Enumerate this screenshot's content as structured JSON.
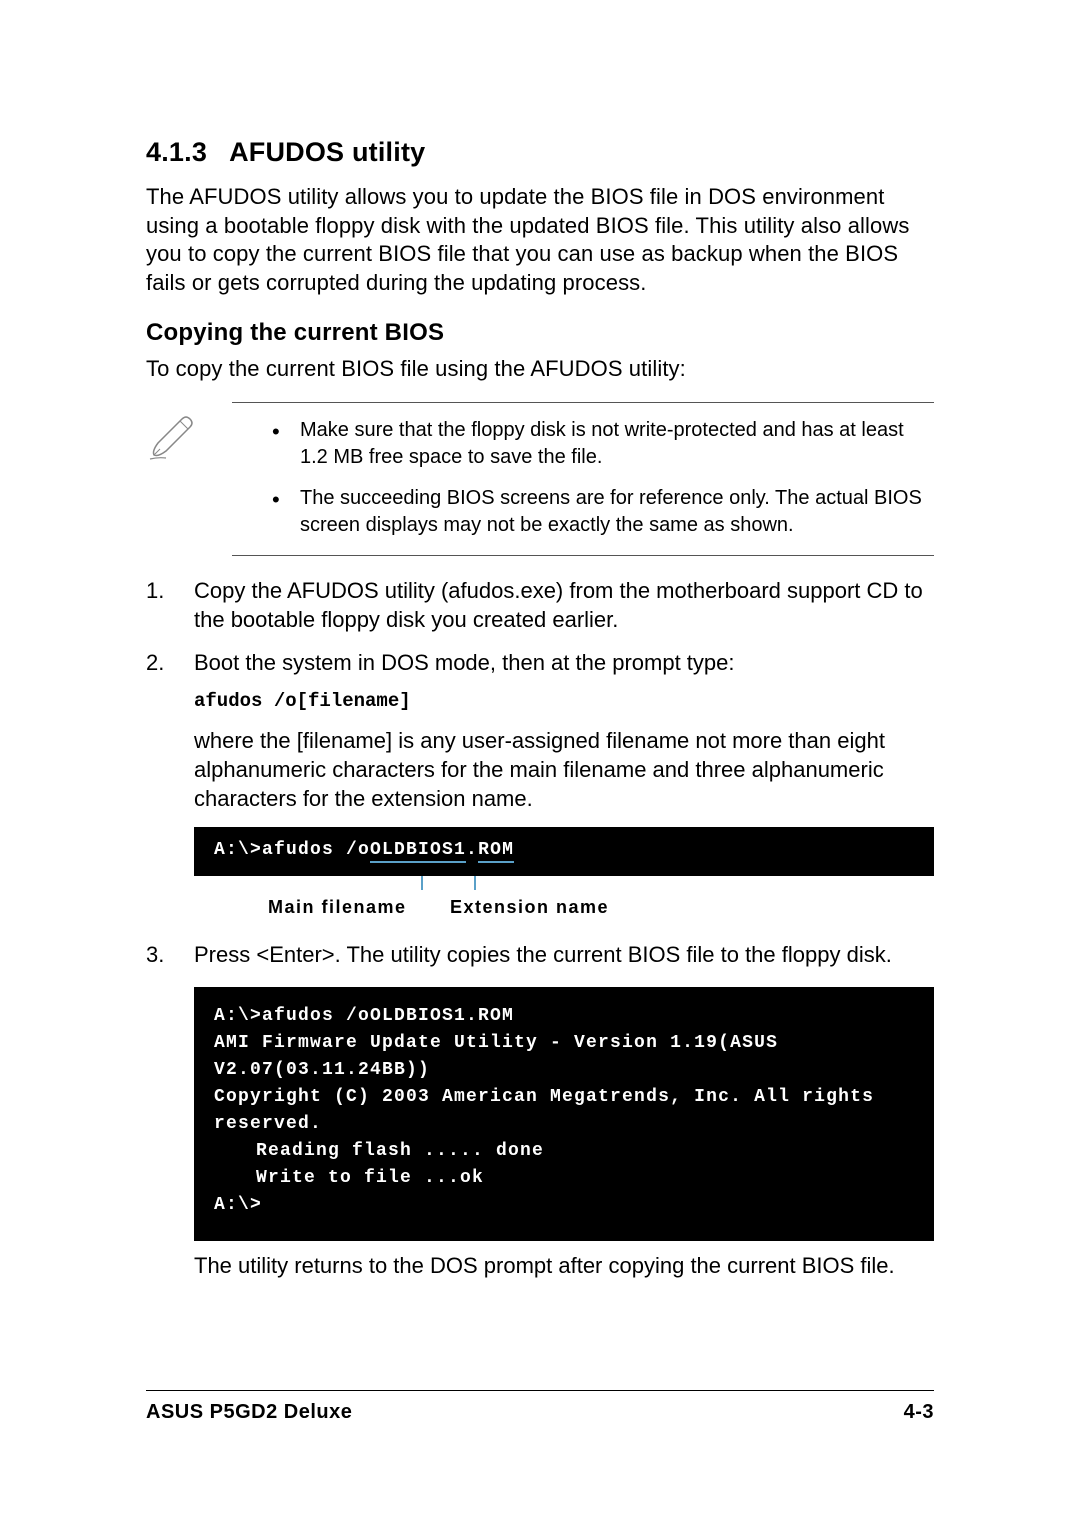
{
  "section": {
    "number": "4.1.3",
    "title": "AFUDOS utility",
    "intro": "The AFUDOS utility allows you to update the BIOS file in DOS environment using a bootable floppy disk with the updated BIOS file. This utility also allows you to copy the current BIOS file that you can use as backup when the BIOS fails or gets corrupted during the updating process."
  },
  "subheading": "Copying the current BIOS",
  "sub_intro": "To copy the current BIOS file using the AFUDOS utility:",
  "notes": [
    "Make sure that the floppy disk is not write-protected and has at least 1.2 MB free space to save the file.",
    "The succeeding BIOS screens are for reference only. The actual BIOS screen displays may not be exactly the same as shown."
  ],
  "steps": {
    "s1": "Copy the AFUDOS utility (afudos.exe) from the motherboard support CD to the bootable floppy disk you created earlier.",
    "s2_text": "Boot the system in DOS mode, then at the prompt type:",
    "s2_cmd": "afudos /o[filename]",
    "s2_explain": "where the [filename] is any user-assigned filename not more than eight alphanumeric characters  for the main filename and three alphanumeric characters for the extension name.",
    "s3_text": "Press <Enter>. The utility copies the current BIOS file to the floppy disk.",
    "s3_after": "The utility returns to the DOS prompt after copying the current BIOS file."
  },
  "terminal1": {
    "prefix": "A:\\>afudos /o",
    "main": "OLDBIOS1",
    "dot": ".",
    "ext": "ROM"
  },
  "terminal1_labels": {
    "main": "Main filename",
    "ext": "Extension name"
  },
  "terminal2": {
    "l1": "A:\\>afudos /oOLDBIOS1.ROM",
    "l2": "AMI Firmware Update Utility - Version 1.19(ASUS V2.07(03.11.24BB))",
    "l3": "Copyright (C) 2003 American Megatrends, Inc. All rights reserved.",
    "l4": "Reading flash ..... done",
    "l5": "Write to file ...ok",
    "l6": "A:\\>"
  },
  "footer": {
    "product": "ASUS P5GD2 Deluxe",
    "page": "4-3"
  }
}
